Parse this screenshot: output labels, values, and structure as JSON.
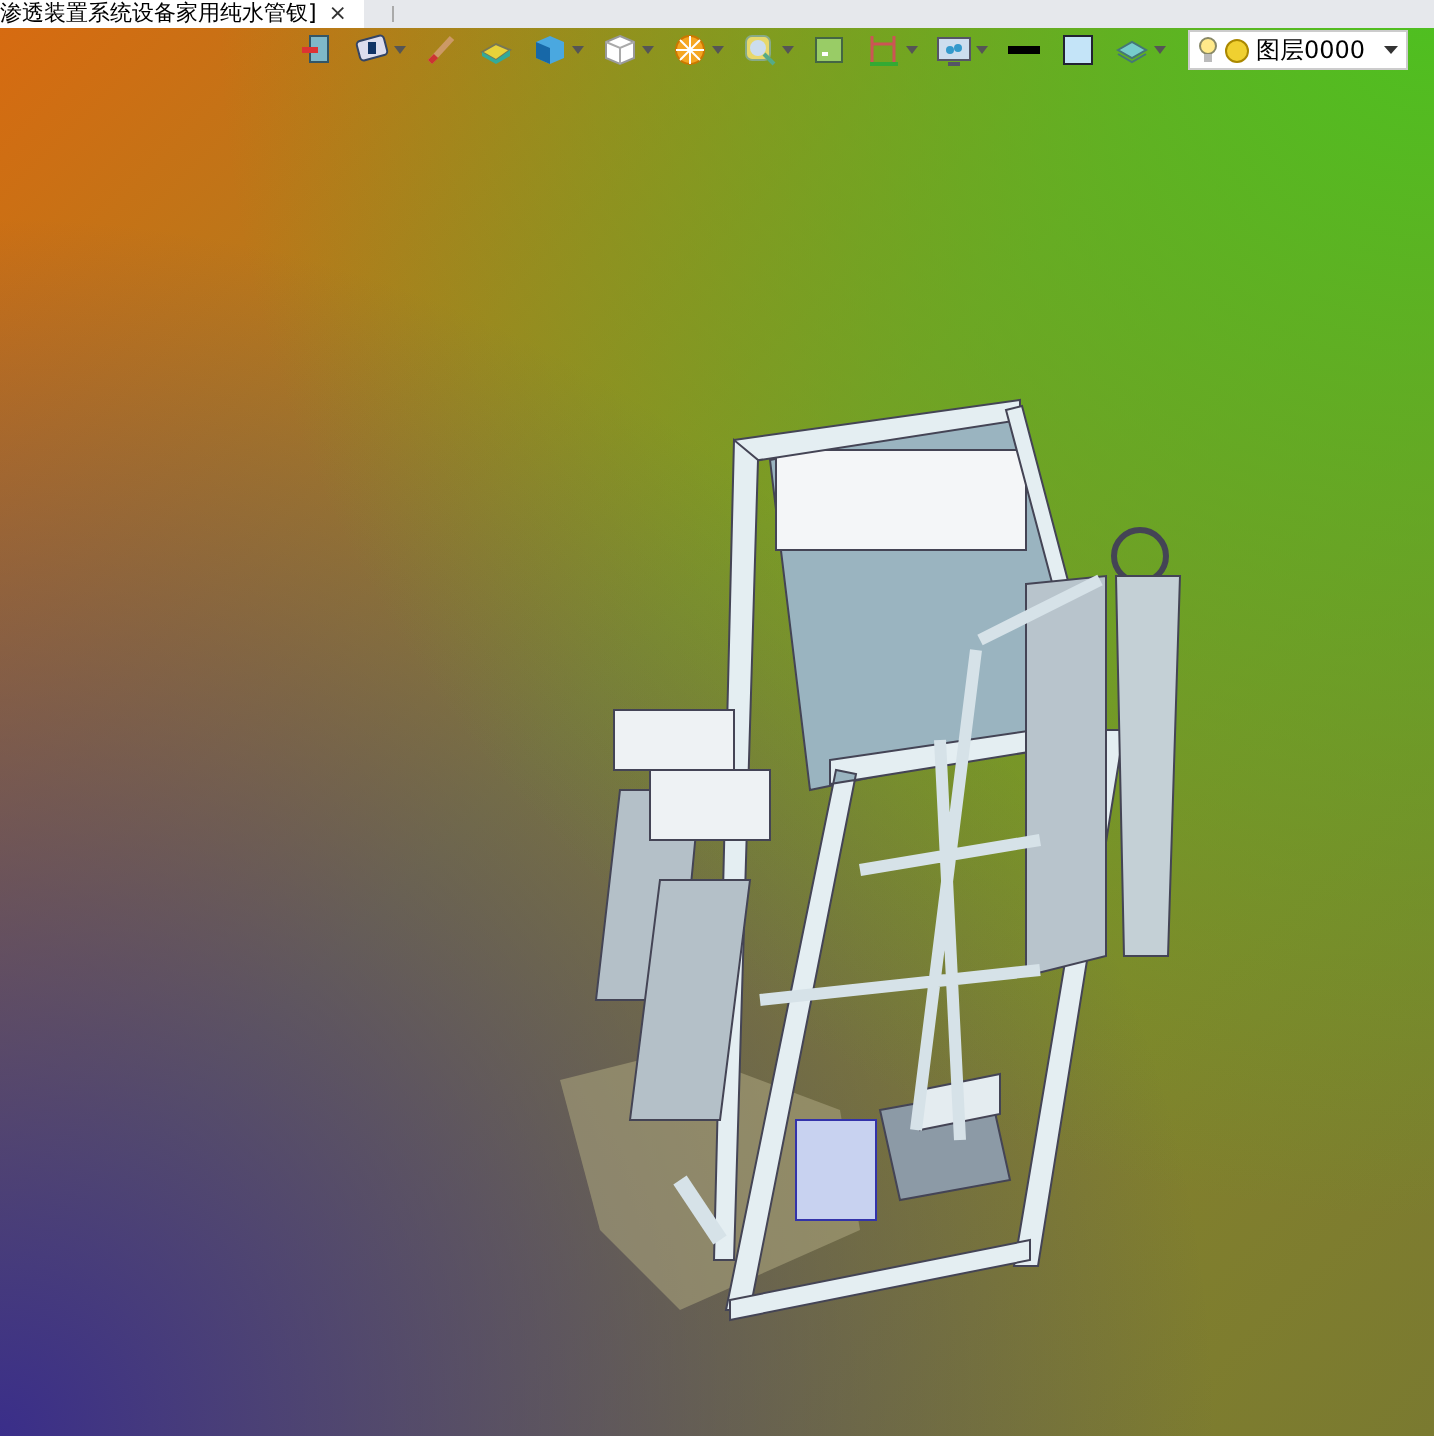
{
  "document_tab": {
    "title": "渗透装置系统设备家用纯水管钗]",
    "close": "×",
    "selected": true
  },
  "toolbar": [
    {
      "kind": "exit",
      "dropdown": false
    },
    {
      "kind": "view",
      "dropdown": true
    },
    {
      "kind": "brush",
      "dropdown": false
    },
    {
      "kind": "solid",
      "dropdown": false
    },
    {
      "kind": "cube",
      "dropdown": true
    },
    {
      "kind": "wireframe",
      "dropdown": true
    },
    {
      "kind": "section",
      "dropdown": true
    },
    {
      "kind": "zoom",
      "dropdown": true
    },
    {
      "kind": "fit",
      "dropdown": false
    },
    {
      "kind": "frame",
      "dropdown": true
    },
    {
      "kind": "display",
      "dropdown": true
    },
    {
      "kind": "line",
      "dropdown": false
    },
    {
      "kind": "fill",
      "dropdown": false
    },
    {
      "kind": "layers",
      "dropdown": true
    }
  ],
  "layer_select": {
    "value": "图层0000",
    "visible": true
  }
}
